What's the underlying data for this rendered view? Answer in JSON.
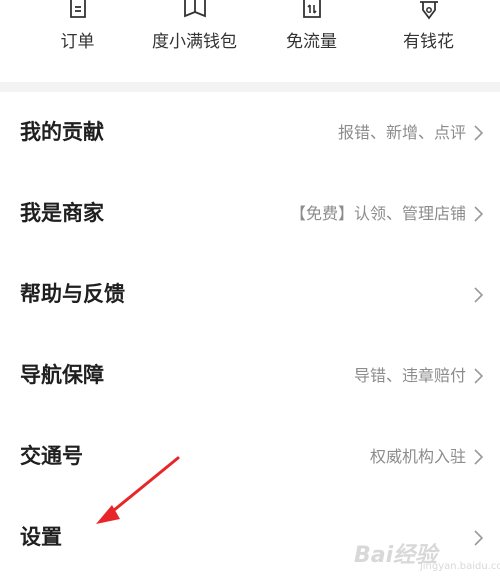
{
  "shortcuts": [
    {
      "label": "订单",
      "icon": "receipt-icon"
    },
    {
      "label": "度小满钱包",
      "icon": "wallet-icon"
    },
    {
      "label": "免流量",
      "icon": "data-traffic-icon"
    },
    {
      "label": "有钱花",
      "icon": "money-loan-icon"
    }
  ],
  "menu": [
    {
      "title": "我的贡献",
      "desc": "报错、新增、点评"
    },
    {
      "title": "我是商家",
      "desc": "【免费】认领、管理店铺"
    },
    {
      "title": "帮助与反馈",
      "desc": ""
    },
    {
      "title": "导航保障",
      "desc": "导错、违章赔付"
    },
    {
      "title": "交通号",
      "desc": "权威机构入驻"
    },
    {
      "title": "设置",
      "desc": ""
    }
  ],
  "annotation": {
    "arrow_color": "#e8262a",
    "target": "设置"
  },
  "watermark": {
    "text": "Bai经验",
    "sub": "jingyan.baidu.com"
  },
  "colors": {
    "separator": "#f3f3f3",
    "desc": "#8c8c8c",
    "title": "#1f1f1f"
  }
}
